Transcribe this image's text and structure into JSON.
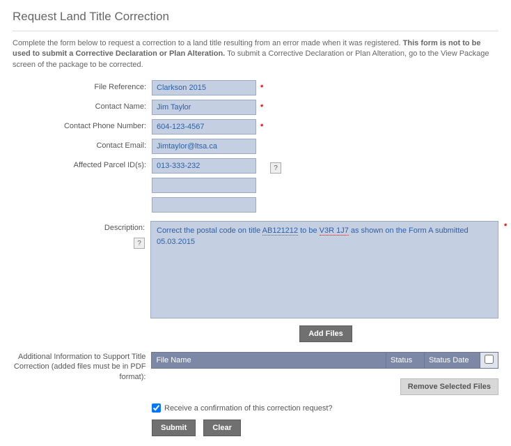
{
  "title": "Request Land Title Correction",
  "intro_plain1": "Complete the form below to request a correction to a land title resulting from an error made when it was registered. ",
  "intro_bold": "This form is not to be used to submit a Corrective Declaration or Plan Alteration.",
  "intro_plain2": " To submit a Corrective Declaration or Plan Alteration, go to the View Package screen of the package to be corrected.",
  "labels": {
    "file_reference": "File Reference:",
    "contact_name": "Contact Name:",
    "contact_phone": "Contact Phone Number:",
    "contact_email": "Contact Email:",
    "parcel_ids": "Affected Parcel ID(s):",
    "description": "Description:",
    "additional_info": "Additional Information to Support Title Correction (added files must be in PDF format):"
  },
  "values": {
    "file_reference": "Clarkson 2015",
    "contact_name": "Jim Taylor",
    "contact_phone": "604-123-4567",
    "contact_email": "Jimtaylor@ltsa.ca",
    "parcel_1": "013-333-232",
    "parcel_2": "",
    "parcel_3": "",
    "desc_pre": "Correct the postal code on title ",
    "desc_ab": "AB121212",
    "desc_mid": " to be ",
    "desc_v3r": "V3R 1J7",
    "desc_post": " as shown on the Form A submitted 05.03.2015"
  },
  "table": {
    "filename": "File Name",
    "status": "Status",
    "status_date": "Status Date"
  },
  "buttons": {
    "add_files": "Add Files",
    "remove": "Remove Selected Files",
    "submit": "Submit",
    "clear": "Clear"
  },
  "confirm_label": "Receive a confirmation of this correction request?",
  "help_glyph": "?",
  "asterisk": "*"
}
